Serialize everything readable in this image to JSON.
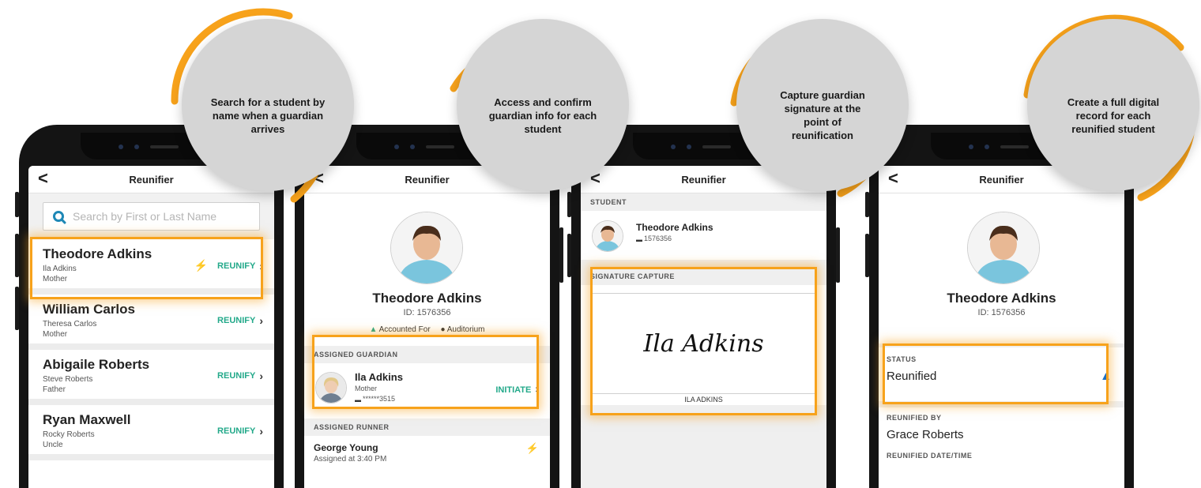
{
  "callouts": [
    "Search for a student by name when a guardian arrives",
    "Access and confirm guardian info for each student",
    "Capture guardian signature at the point of reunification",
    "Create a full digital record for each reunified student"
  ],
  "app": {
    "title": "Reunifier",
    "back": "<"
  },
  "screen1": {
    "search_placeholder": "Search by First or Last Name",
    "action_label": "REUNIFY",
    "students": [
      {
        "name": "Theodore Adkins",
        "guardian": "Ila Adkins",
        "relation": "Mother"
      },
      {
        "name": "William Carlos",
        "guardian": "Theresa Carlos",
        "relation": "Mother"
      },
      {
        "name": "Abigaile Roberts",
        "guardian": "Steve Roberts",
        "relation": "Father"
      },
      {
        "name": "Ryan Maxwell",
        "guardian": "Rocky Roberts",
        "relation": "Uncle"
      }
    ]
  },
  "screen2": {
    "name": "Theodore Adkins",
    "id": "ID: 1576356",
    "status": "Accounted For",
    "location": "Auditorium",
    "guardian_header": "ASSIGNED GUARDIAN",
    "guardian_name": "Ila Adkins",
    "guardian_relation": "Mother",
    "guardian_card": "******3515",
    "initiate": "INITIATE",
    "runner_header": "ASSIGNED RUNNER",
    "runner_name": "George Young",
    "runner_time": "Assigned at 3:40 PM"
  },
  "screen3": {
    "student_header": "STUDENT",
    "student_name": "Theodore Adkins",
    "student_id": "1576356",
    "signature_header": "SIGNATURE CAPTURE",
    "signature": "Ila Adkins",
    "signer": "ILA ADKINS"
  },
  "screen4": {
    "name": "Theodore Adkins",
    "id": "ID: 1576356",
    "status_header": "STATUS",
    "status_value": "Reunified",
    "by_header": "REUNIFIED BY",
    "by_value": "Grace Roberts",
    "time_header": "REUNIFIED DATE/TIME"
  },
  "colors": {
    "accent": "#f7a21b",
    "action": "#23a98a",
    "search_icon": "#1e88b6",
    "callout_bg": "#d5d5d5"
  }
}
